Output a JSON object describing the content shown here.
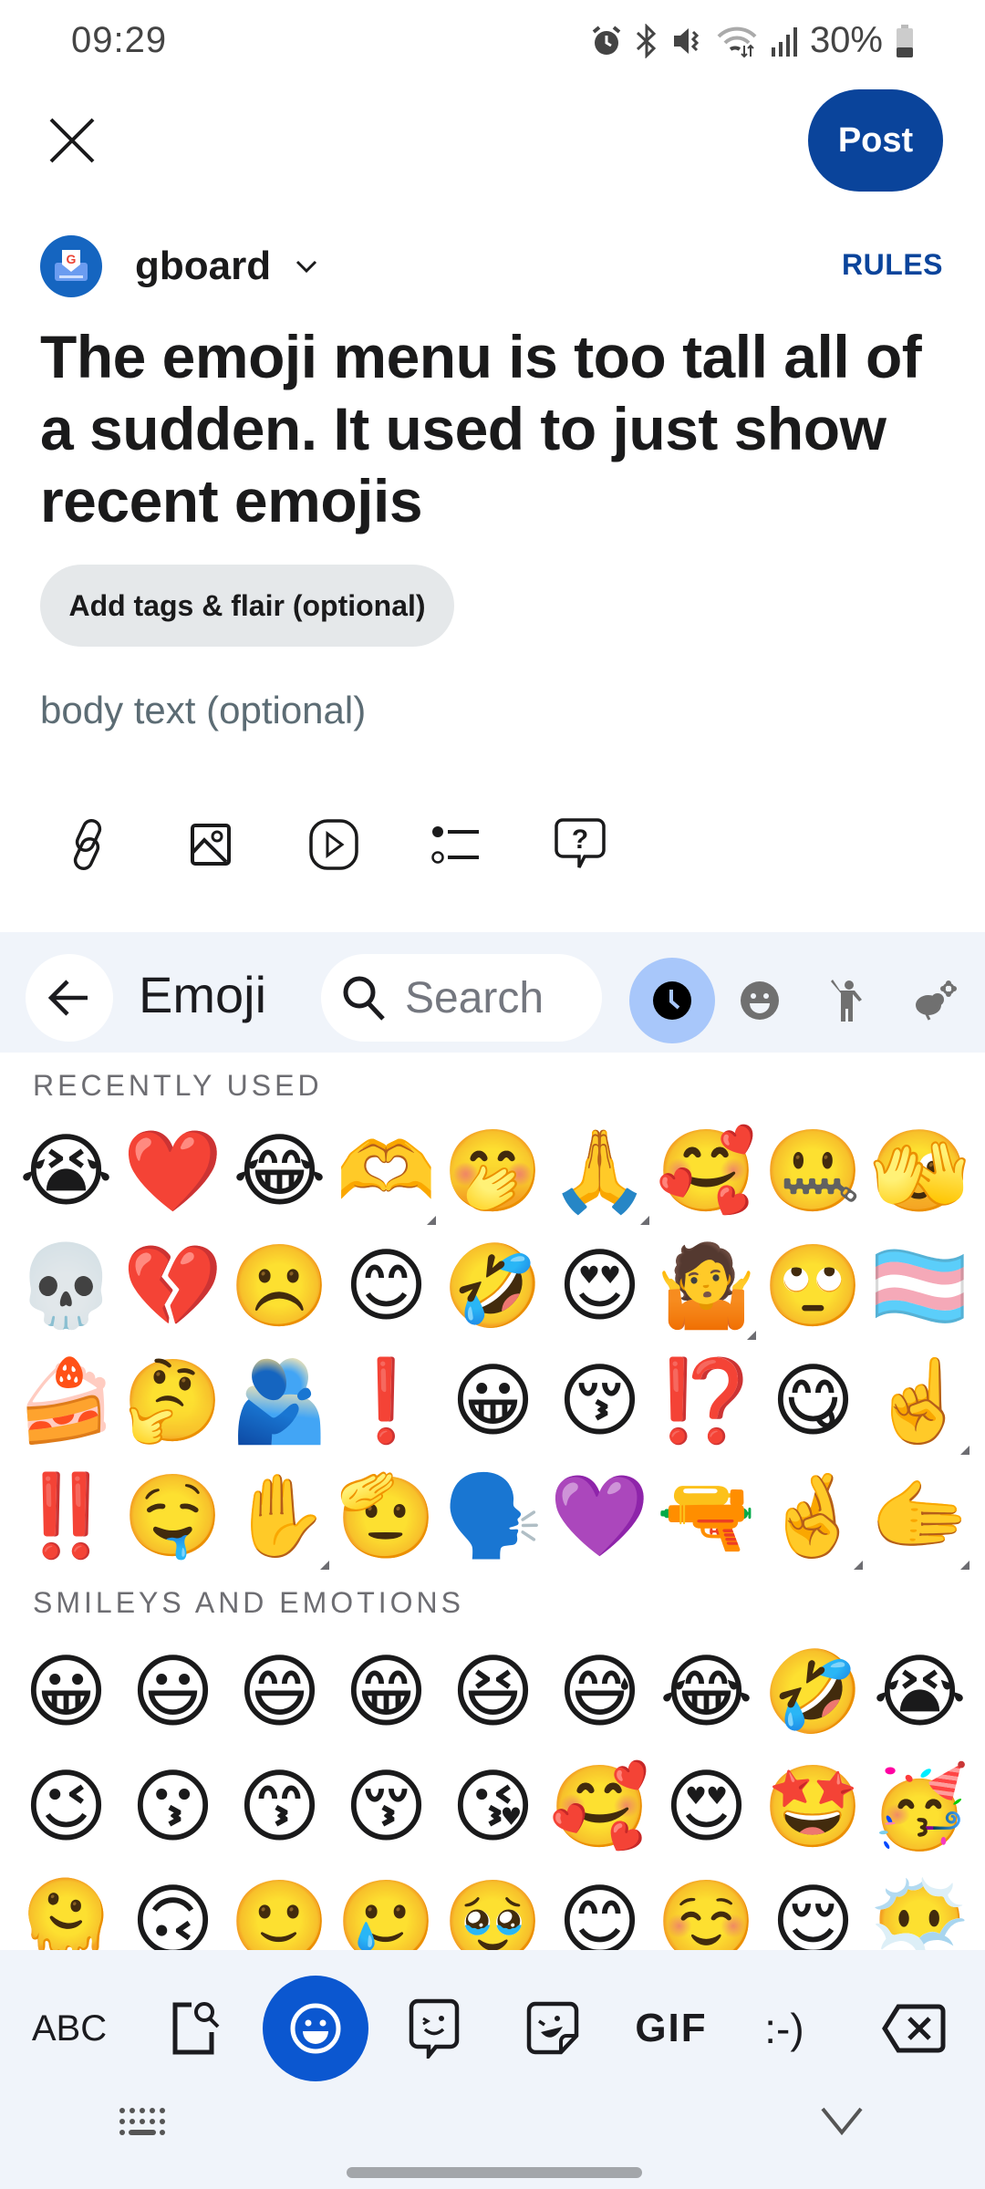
{
  "status_bar": {
    "time": "09:29",
    "battery": "30%",
    "icons": [
      "alarm-icon",
      "bluetooth-icon",
      "vibrate-mute-icon",
      "wifi-icon",
      "signal-icon",
      "battery-icon"
    ]
  },
  "top_bar": {
    "close_icon": "close-icon",
    "post_label": "Post"
  },
  "community": {
    "name": "gboard",
    "rules_label": "RULES"
  },
  "post": {
    "title": "The emoji menu is too tall all of a sudden. It used to just show recent emojis",
    "flair_label": "Add tags & flair (optional)",
    "body_placeholder": "body text (optional)",
    "body_value": "",
    "toolbar": [
      "link-icon",
      "image-icon",
      "video-icon",
      "poll-icon",
      "ask-question-icon"
    ]
  },
  "keyboard": {
    "back_icon": "arrow-back-icon",
    "title": "Emoji",
    "search_placeholder": "Search",
    "search_value": "",
    "categories": [
      {
        "name": "recent",
        "icon": "clock-icon",
        "active": true
      },
      {
        "name": "smileys",
        "icon": "smiley-icon",
        "active": false
      },
      {
        "name": "people",
        "icon": "person-icon",
        "active": false
      },
      {
        "name": "animals-nature",
        "icon": "bee-flower-icon",
        "active": false
      }
    ],
    "sections": [
      {
        "label": "RECENTLY USED",
        "emojis": [
          {
            "char": "😭",
            "variants": false
          },
          {
            "char": "❤️",
            "variants": false
          },
          {
            "char": "😂",
            "variants": false
          },
          {
            "char": "🫶",
            "variants": true
          },
          {
            "char": "🤭",
            "variants": false
          },
          {
            "char": "🙏",
            "variants": true
          },
          {
            "char": "🥰",
            "variants": false
          },
          {
            "char": "🤐",
            "variants": false
          },
          {
            "char": "🫣",
            "variants": false
          },
          {
            "char": "💀",
            "variants": false
          },
          {
            "char": "💔",
            "variants": false
          },
          {
            "char": "☹️",
            "variants": false
          },
          {
            "char": "😊",
            "variants": false
          },
          {
            "char": "🤣",
            "variants": false
          },
          {
            "char": "😍",
            "variants": false
          },
          {
            "char": "🤷",
            "variants": true
          },
          {
            "char": "🙄",
            "variants": false
          },
          {
            "char": "🏳️‍⚧️",
            "variants": false
          },
          {
            "char": "🍰",
            "variants": false
          },
          {
            "char": "🤔",
            "variants": false
          },
          {
            "char": "🫂",
            "variants": false
          },
          {
            "char": "❗",
            "variants": false
          },
          {
            "char": "😀",
            "variants": false
          },
          {
            "char": "😚",
            "variants": false
          },
          {
            "char": "⁉️",
            "variants": false
          },
          {
            "char": "😋",
            "variants": false
          },
          {
            "char": "☝️",
            "variants": true
          },
          {
            "char": "‼️",
            "variants": false
          },
          {
            "char": "🤤",
            "variants": false
          },
          {
            "char": "✋",
            "variants": true
          },
          {
            "char": "🫡",
            "variants": false
          },
          {
            "char": "🗣️",
            "variants": false
          },
          {
            "char": "💜",
            "variants": false
          },
          {
            "char": "🔫",
            "variants": false
          },
          {
            "char": "🤞",
            "variants": true
          },
          {
            "char": "🫱",
            "variants": true
          }
        ]
      },
      {
        "label": "SMILEYS AND EMOTIONS",
        "emojis": [
          {
            "char": "😀",
            "variants": false
          },
          {
            "char": "😃",
            "variants": false
          },
          {
            "char": "😄",
            "variants": false
          },
          {
            "char": "😁",
            "variants": false
          },
          {
            "char": "😆",
            "variants": false
          },
          {
            "char": "😅",
            "variants": false
          },
          {
            "char": "😂",
            "variants": false
          },
          {
            "char": "🤣",
            "variants": false
          },
          {
            "char": "😭",
            "variants": false
          },
          {
            "char": "😉",
            "variants": false
          },
          {
            "char": "😗",
            "variants": false
          },
          {
            "char": "😙",
            "variants": false
          },
          {
            "char": "😚",
            "variants": false
          },
          {
            "char": "😘",
            "variants": false
          },
          {
            "char": "🥰",
            "variants": false
          },
          {
            "char": "😍",
            "variants": false
          },
          {
            "char": "🤩",
            "variants": false
          },
          {
            "char": "🥳",
            "variants": false
          },
          {
            "char": "🫠",
            "variants": false
          },
          {
            "char": "🙃",
            "variants": false
          },
          {
            "char": "🙂",
            "variants": false
          },
          {
            "char": "🥲",
            "variants": false
          },
          {
            "char": "🥹",
            "variants": false
          },
          {
            "char": "😊",
            "variants": false
          },
          {
            "char": "☺️",
            "variants": false
          },
          {
            "char": "😌",
            "variants": false
          },
          {
            "char": "😶‍🌫️",
            "variants": false
          }
        ]
      }
    ],
    "bottom_tabs": [
      {
        "name": "abc",
        "label": "ABC"
      },
      {
        "name": "search-content",
        "icon": "search-page-icon"
      },
      {
        "name": "emoji",
        "icon": "emoji-icon",
        "active": true
      },
      {
        "name": "emoji-kitchen",
        "icon": "sticker-chat-icon"
      },
      {
        "name": "stickers",
        "icon": "sticker-icon"
      },
      {
        "name": "gif",
        "label": "GIF"
      },
      {
        "name": "emoticons",
        "label": ":-)"
      },
      {
        "name": "backspace",
        "icon": "backspace-icon"
      }
    ],
    "colors": {
      "accent": "#0b57d0",
      "active_category": "#a8c7fa",
      "keyboard_bg": "#f0f4fa"
    }
  },
  "colors": {
    "post_button": "#0a449b",
    "rules_link": "#0a449b",
    "flair_bg": "#e5e8ea",
    "placeholder": "#5c6c74"
  }
}
